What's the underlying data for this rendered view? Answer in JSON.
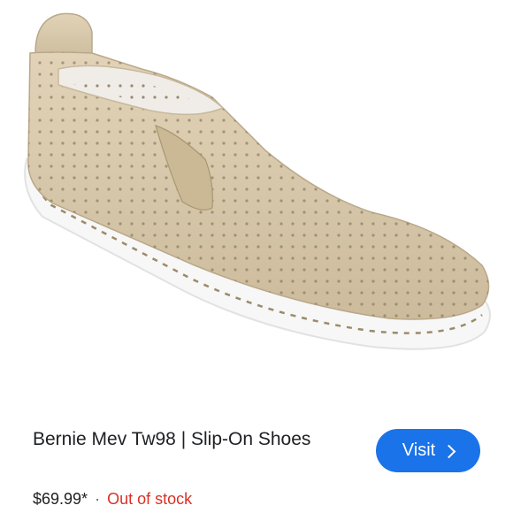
{
  "product": {
    "title": "Bernie Mev Tw98 | Slip-On Shoes",
    "price": "$69.99*",
    "separator": "·",
    "stock_status": "Out of stock"
  },
  "actions": {
    "visit_label": "Visit"
  },
  "image": {
    "subject": "beige perforated suede slip-on shoe with white sole",
    "colors": {
      "upper": "#d8c8ac",
      "sole": "#f7f7f7",
      "stitch": "#9c8a6a"
    }
  },
  "colors": {
    "button": "#1a73e8",
    "stock": "#d93025",
    "text": "#202124"
  }
}
